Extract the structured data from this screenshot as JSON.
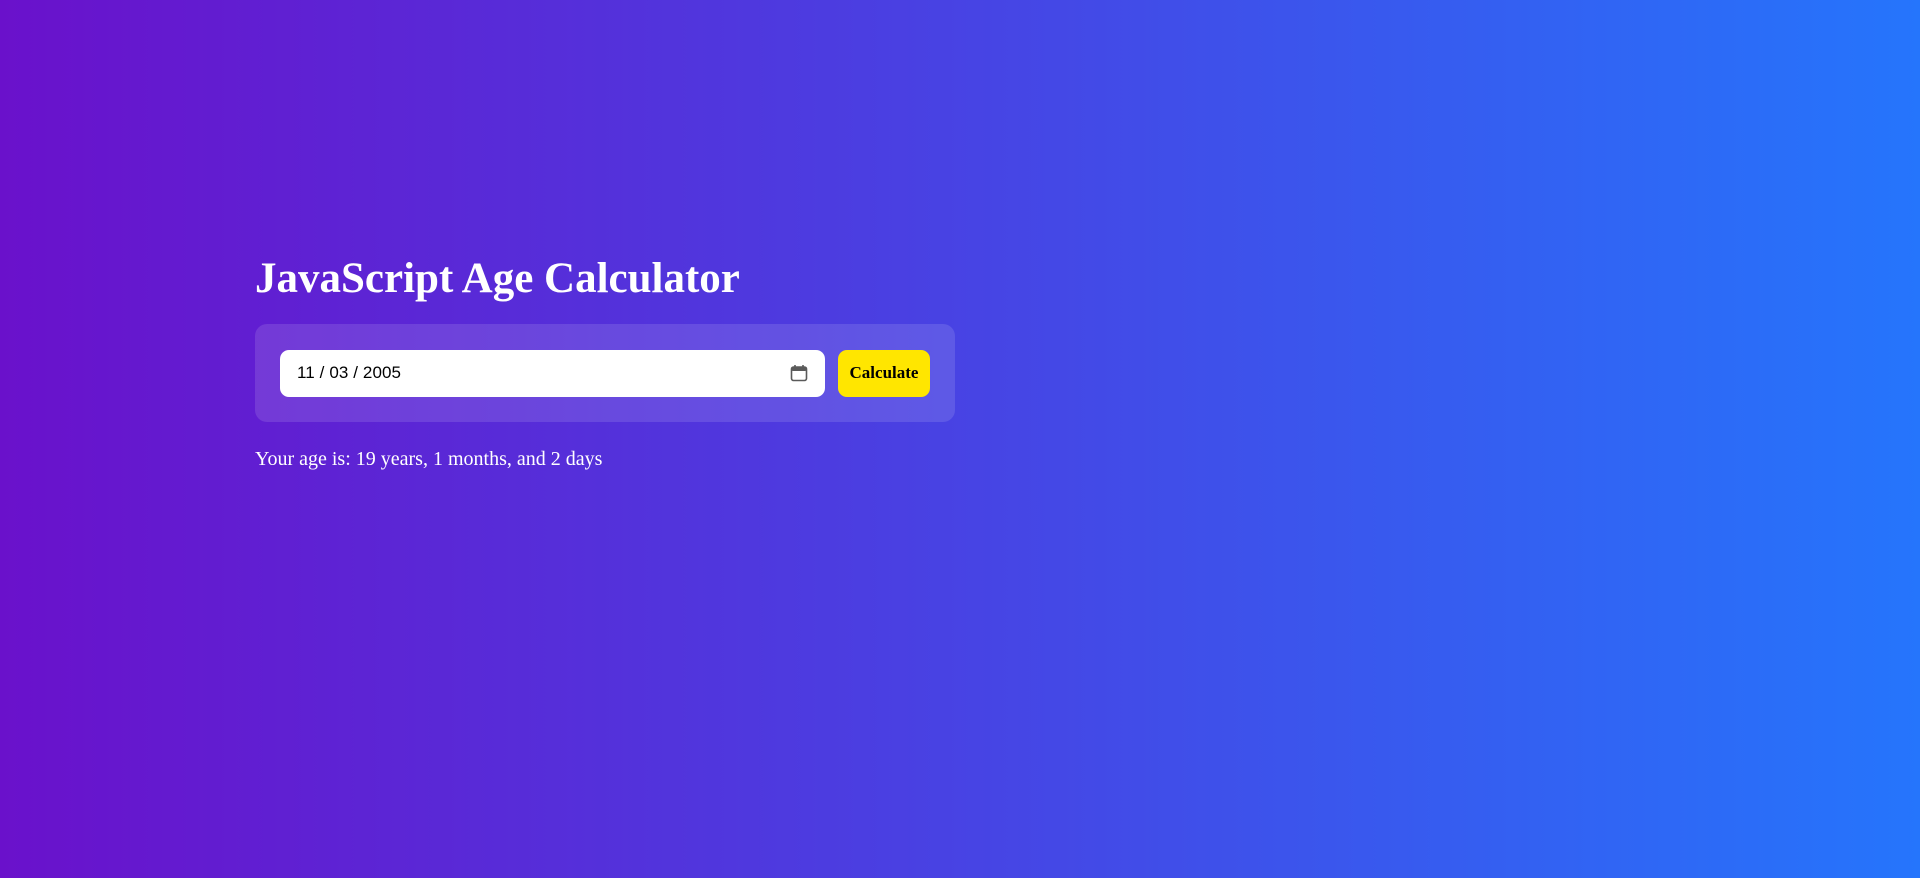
{
  "app": {
    "title": "JavaScript Age Calculator"
  },
  "form": {
    "date_value": "11 / 03 / 2005",
    "calendar_icon": "calendar-icon",
    "calculate_label": "Calculate"
  },
  "result": {
    "text": "Your age is: 19 years, 1 months, and 2 days"
  },
  "colors": {
    "gradient_start": "#6a11cb",
    "gradient_end": "#2575fc",
    "button": "#ffe600",
    "text": "#ffffff"
  }
}
